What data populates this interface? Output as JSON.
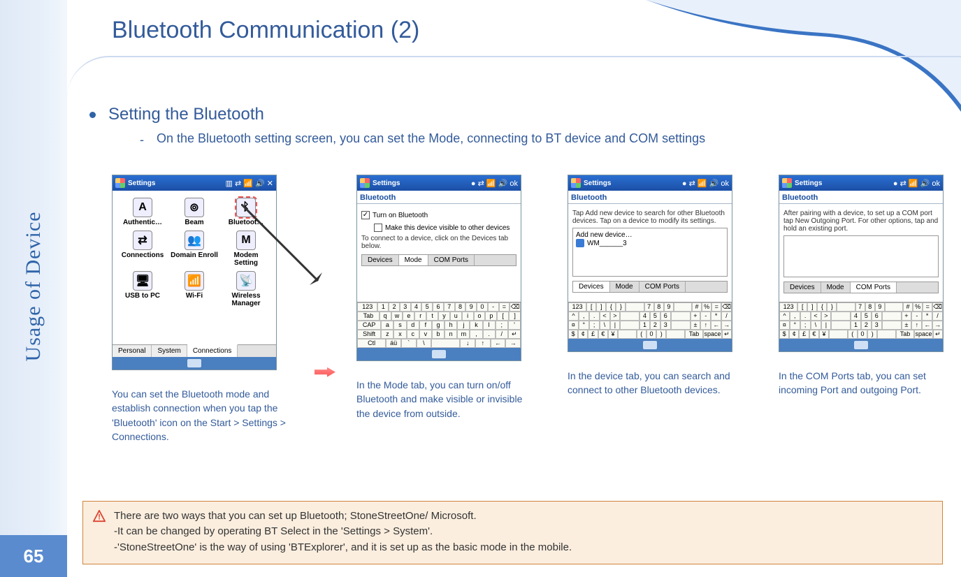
{
  "meta": {
    "page_number": "65",
    "section": "Usage of Device"
  },
  "title": "Bluetooth Communication (2)",
  "heading": {
    "main": "Setting the Bluetooth",
    "sub": "On the Bluetooth setting screen, you can set the Mode, connecting to BT device and COM  settings"
  },
  "captions": {
    "c1": "You can set the Bluetooth mode and establish connection when you tap the 'Bluetooth' icon on the Start > Settings > Connections.",
    "c2": "In the Mode tab, you can turn on/off Bluetooth and make visible or invisible the device from outside.",
    "c3": "In the device tab, you can search and connect to other Bluetooth devices.",
    "c4": "In the COM Ports tab, you can set incoming Port and outgoing Port."
  },
  "warning": {
    "line1": "There are two ways that you can set up Bluetooth; StoneStreetOne/ Microsoft.",
    "line2": "-It can be changed by operating BT Select in the 'Settings > System'.",
    "line3": "-'StoneStreetOne' is the way of using 'BTExplorer', and it is set up as the basic mode in the mobile."
  },
  "shot1": {
    "title": "Settings",
    "apps": [
      "Authentic…",
      "Beam",
      "Bluetoot…",
      "Connections",
      "Domain Enroll",
      "Modem Setting",
      "USB to PC",
      "Wi-Fi",
      "Wireless Manager"
    ],
    "tabs": [
      "Personal",
      "System",
      "Connections"
    ],
    "active_tab_index": 2
  },
  "shot2": {
    "title": "Settings",
    "head": "Bluetooth",
    "chk1": "Turn on Bluetooth",
    "chk2": "Make this device visible to other devices",
    "note": "To connect to a device, click on the Devices tab below.",
    "tabs": [
      "Devices",
      "Mode",
      "COM Ports"
    ],
    "active_tab_index": 1
  },
  "shot3": {
    "title": "Settings",
    "head": "Bluetooth",
    "note": "Tap Add new device to search for other Bluetooth devices. Tap on a device to modify its settings.",
    "add": "Add new device…",
    "item": "WM______3",
    "tabs": [
      "Devices",
      "Mode",
      "COM Ports"
    ],
    "active_tab_index": 0
  },
  "shot4": {
    "title": "Settings",
    "head": "Bluetooth",
    "note": "After pairing with a device, to set up a COM port tap New Outgoing Port. For other options, tap and hold an existing port.",
    "tabs": [
      "Devices",
      "Mode",
      "COM Ports"
    ],
    "active_tab_index": 2
  },
  "keyboard": {
    "r1": [
      "123",
      "1",
      "2",
      "3",
      "4",
      "5",
      "6",
      "7",
      "8",
      "9",
      "0",
      "-",
      "=",
      "⌫"
    ],
    "r2": [
      "Tab",
      "q",
      "w",
      "e",
      "r",
      "t",
      "y",
      "u",
      "i",
      "o",
      "p",
      "[",
      "]"
    ],
    "r3": [
      "CAP",
      "a",
      "s",
      "d",
      "f",
      "g",
      "h",
      "j",
      "k",
      "l",
      ";",
      "'"
    ],
    "r4": [
      "Shift",
      "z",
      "x",
      "c",
      "v",
      "b",
      "n",
      "m",
      ",",
      ".",
      "/",
      "↵"
    ],
    "r5": [
      "Ctl",
      "áü",
      "`",
      "\\",
      " ",
      "↓",
      "↑",
      "←",
      "→"
    ]
  },
  "keyboard_sym": {
    "r1": [
      "123",
      "[",
      "]",
      "{",
      "}",
      " ",
      "7",
      "8",
      "9",
      " ",
      "#",
      "%",
      "=",
      "⌫"
    ],
    "r2": [
      "^",
      ",",
      ".",
      "<",
      ">",
      " ",
      "4",
      "5",
      "6",
      " ",
      "+",
      "-",
      "*",
      "/"
    ],
    "r3": [
      "¤",
      "°",
      ";",
      "\\",
      "|",
      " ",
      "1",
      "2",
      "3",
      " ",
      "±",
      "↑",
      "←",
      "→"
    ],
    "r4": [
      "$",
      "¢",
      "£",
      "€",
      "¥",
      " ",
      "(",
      "0",
      ")",
      " ",
      "Tab",
      "space",
      "↵"
    ]
  }
}
